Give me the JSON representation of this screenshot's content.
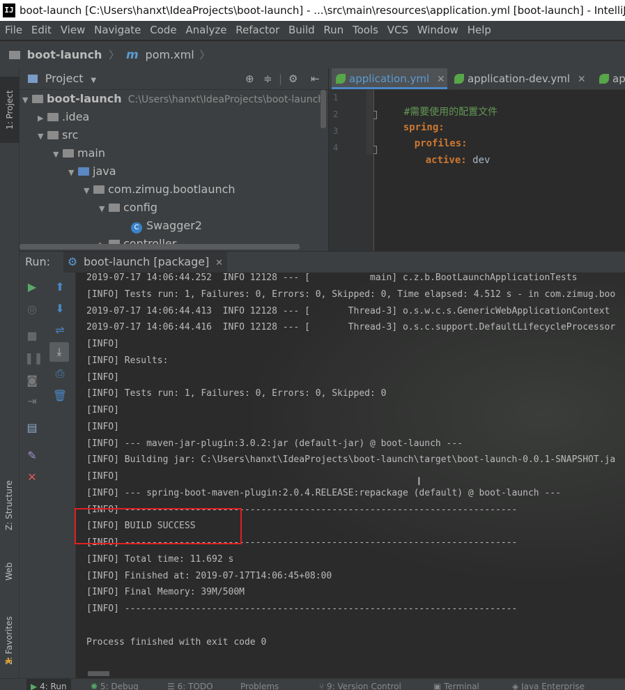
{
  "window": {
    "title": "boot-launch [C:\\Users\\hanxt\\IdeaProjects\\boot-launch] - ...\\src\\main\\resources\\application.yml [boot-launch] - IntelliJ IDEA",
    "logo_text": "IJ"
  },
  "menu": [
    "File",
    "Edit",
    "View",
    "Navigate",
    "Code",
    "Analyze",
    "Refactor",
    "Build",
    "Run",
    "Tools",
    "VCS",
    "Window",
    "Help"
  ],
  "breadcrumb": {
    "project": "boot-launch",
    "file_icon": "m",
    "file": "pom.xml"
  },
  "left_tabs": {
    "project": "1: Project",
    "structure": "Z: Structure",
    "web": "Web",
    "favorites": "2: Favorites"
  },
  "project_panel": {
    "title": "Project",
    "tree": [
      {
        "label": "boot-launch",
        "path": "C:\\Users\\hanxt\\IdeaProjects\\boot-launch"
      },
      {
        "label": ".idea"
      },
      {
        "label": "src"
      },
      {
        "label": "main"
      },
      {
        "label": "java"
      },
      {
        "label": "com.zimug.bootlaunch"
      },
      {
        "label": "config"
      },
      {
        "label": "Swagger2",
        "icon_letter": "C"
      },
      {
        "label": "controller"
      }
    ]
  },
  "editor": {
    "tabs": [
      {
        "label": "application.yml",
        "active": true
      },
      {
        "label": "application-dev.yml",
        "active": false
      },
      {
        "label": "ap",
        "active": false
      }
    ],
    "lines": [
      {
        "num": "1",
        "comment": "#需要使用的配置文件"
      },
      {
        "num": "2",
        "key": "spring:"
      },
      {
        "num": "3",
        "key": "profiles:"
      },
      {
        "num": "4",
        "key": "active:",
        "value": " dev"
      }
    ]
  },
  "run_panel": {
    "label": "Run:",
    "config": "boot-launch [package]",
    "console_lines": [
      "2019-07-17 14:06:44.252  INFO 12128 --- [           main] c.z.b.BootLaunchApplicationTests",
      "[INFO] Tests run: 1, Failures: 0, Errors: 0, Skipped: 0, Time elapsed: 4.512 s - in com.zimug.boo",
      "2019-07-17 14:06:44.413  INFO 12128 --- [       Thread-3] o.s.w.c.s.GenericWebApplicationContext",
      "2019-07-17 14:06:44.416  INFO 12128 --- [       Thread-3] o.s.c.support.DefaultLifecycleProcessor",
      "[INFO]",
      "[INFO] Results:",
      "[INFO]",
      "[INFO] Tests run: 1, Failures: 0, Errors: 0, Skipped: 0",
      "[INFO]",
      "[INFO]",
      "[INFO] --- maven-jar-plugin:3.0.2:jar (default-jar) @ boot-launch ---",
      "[INFO] Building jar: C:\\Users\\hanxt\\IdeaProjects\\boot-launch\\target\\boot-launch-0.0.1-SNAPSHOT.ja",
      "[INFO]",
      "[INFO] --- spring-boot-maven-plugin:2.0.4.RELEASE:repackage (default) @ boot-launch ---",
      "[INFO] ------------------------------------------------------------------------",
      "[INFO] BUILD SUCCESS",
      "[INFO] ------------------------------------------------------------------------",
      "[INFO] Total time: 11.692 s",
      "[INFO] Finished at: 2019-07-17T14:06:45+08:00",
      "[INFO] Final Memory: 39M/500M",
      "[INFO] ------------------------------------------------------------------------",
      "",
      "Process finished with exit code 0"
    ]
  },
  "bottom_tabs": [
    "4: Run",
    "5: Debug",
    "6: TODO",
    "Problems",
    "9: Version Control",
    "Terminal",
    "Java Enterprise"
  ],
  "colors": {
    "accent_blue": "#4a88c7",
    "run_green": "#59a869",
    "stop_red": "#e05555",
    "yaml_key": "#cc7832",
    "comment": "#629755",
    "highlight_box": "#e02020"
  }
}
